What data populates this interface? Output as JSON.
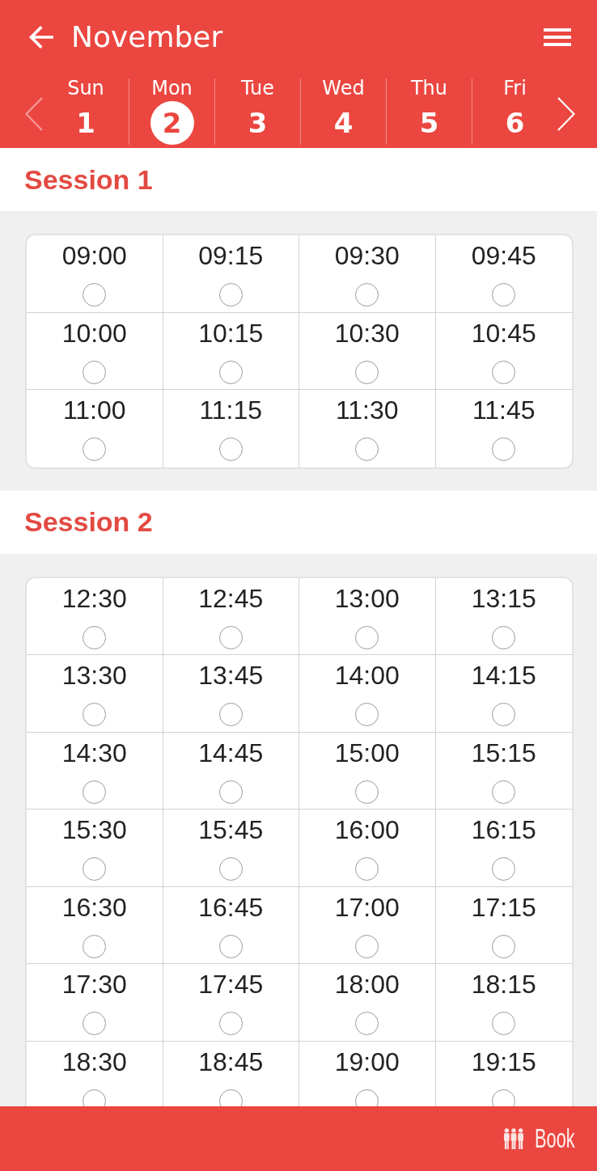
{
  "header": {
    "title": "November"
  },
  "week": {
    "prev": {
      "disabled": true
    },
    "next": {
      "disabled": false
    },
    "days": [
      {
        "day": "Sun",
        "date": "1",
        "selected": false
      },
      {
        "day": "Mon",
        "date": "2",
        "selected": true
      },
      {
        "day": "Tue",
        "date": "3",
        "selected": false
      },
      {
        "day": "Wed",
        "date": "4",
        "selected": false
      },
      {
        "day": "Thu",
        "date": "5",
        "selected": false
      },
      {
        "day": "Fri",
        "date": "6",
        "selected": false
      }
    ]
  },
  "sessions": [
    {
      "title": "Session 1",
      "slots": [
        {
          "time": "09:00",
          "selected": false
        },
        {
          "time": "09:15",
          "selected": false
        },
        {
          "time": "09:30",
          "selected": false
        },
        {
          "time": "09:45",
          "selected": false
        },
        {
          "time": "10:00",
          "selected": false
        },
        {
          "time": "10:15",
          "selected": false
        },
        {
          "time": "10:30",
          "selected": false
        },
        {
          "time": "10:45",
          "selected": false
        },
        {
          "time": "11:00",
          "selected": false
        },
        {
          "time": "11:15",
          "selected": false
        },
        {
          "time": "11:30",
          "selected": false
        },
        {
          "time": "11:45",
          "selected": false
        }
      ]
    },
    {
      "title": "Session 2",
      "slots": [
        {
          "time": "12:30",
          "selected": false
        },
        {
          "time": "12:45",
          "selected": false
        },
        {
          "time": "13:00",
          "selected": false
        },
        {
          "time": "13:15",
          "selected": false
        },
        {
          "time": "13:30",
          "selected": false
        },
        {
          "time": "13:45",
          "selected": false
        },
        {
          "time": "14:00",
          "selected": false
        },
        {
          "time": "14:15",
          "selected": false
        },
        {
          "time": "14:30",
          "selected": false
        },
        {
          "time": "14:45",
          "selected": false
        },
        {
          "time": "15:00",
          "selected": false
        },
        {
          "time": "15:15",
          "selected": false
        },
        {
          "time": "15:30",
          "selected": false
        },
        {
          "time": "15:45",
          "selected": false
        },
        {
          "time": "16:00",
          "selected": false
        },
        {
          "time": "16:15",
          "selected": false
        },
        {
          "time": "16:30",
          "selected": false
        },
        {
          "time": "16:45",
          "selected": false
        },
        {
          "time": "17:00",
          "selected": false
        },
        {
          "time": "17:15",
          "selected": false
        },
        {
          "time": "17:30",
          "selected": false
        },
        {
          "time": "17:45",
          "selected": false
        },
        {
          "time": "18:00",
          "selected": false
        },
        {
          "time": "18:15",
          "selected": false
        },
        {
          "time": "18:30",
          "selected": false
        },
        {
          "time": "18:45",
          "selected": false
        },
        {
          "time": "19:00",
          "selected": false
        },
        {
          "time": "19:15",
          "selected": false
        }
      ]
    }
  ],
  "footer": {
    "book_label": "Book"
  }
}
